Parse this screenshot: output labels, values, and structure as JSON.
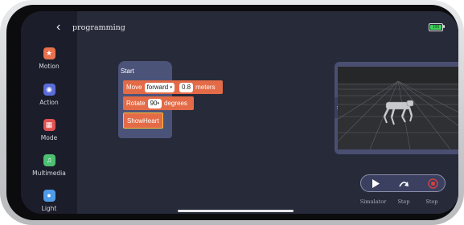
{
  "header": {
    "title": "programming",
    "back_icon": "chevron-left-icon",
    "battery_icon": "battery-icon",
    "battery_text": "100"
  },
  "sidebar": {
    "items": [
      {
        "label": "Motion",
        "icon": "motion-icon",
        "color": "#e8714e"
      },
      {
        "label": "Action",
        "icon": "action-icon",
        "color": "#5a6cd8"
      },
      {
        "label": "Mode",
        "icon": "mode-icon",
        "color": "#e05150"
      },
      {
        "label": "Multimedia",
        "icon": "music-note-icon",
        "color": "#4cbf72"
      },
      {
        "label": "Light",
        "icon": "light-icon",
        "color": "#4e9be8"
      }
    ]
  },
  "program": {
    "start_label": "Start",
    "blocks": [
      {
        "type": "move",
        "prefix": "Move",
        "direction": "forward",
        "distance": "0.8",
        "unit": "meters"
      },
      {
        "type": "rotate",
        "prefix": "Rotate",
        "angle": "90",
        "unit": "degrees"
      },
      {
        "type": "show",
        "label": "ShowHeart"
      }
    ]
  },
  "simulator": {
    "toggle_icon": "chevron-right-icon"
  },
  "controls": {
    "simulator_label": "Simulator",
    "step_label": "Step",
    "stop_label": "Stop",
    "stop_color": "#e0403f"
  }
}
